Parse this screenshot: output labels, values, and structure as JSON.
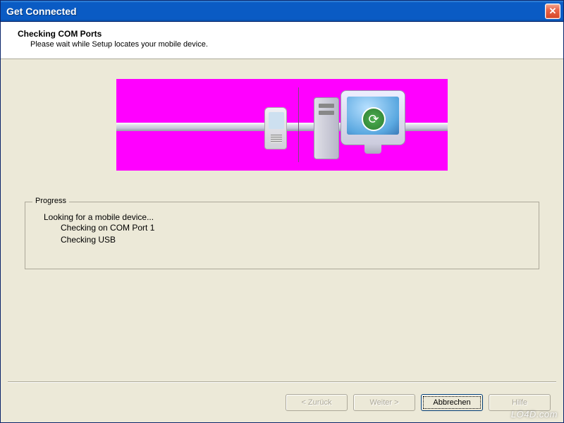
{
  "window": {
    "title": "Get Connected",
    "close_label": "✕"
  },
  "header": {
    "title": "Checking COM Ports",
    "subtitle": "Please wait while Setup locates your mobile device."
  },
  "illustration": {
    "phone_icon": "mobile-phone",
    "computer_icon": "desktop-computer",
    "sync_icon": "sync-arrows",
    "bg_color": "#ff00ff"
  },
  "progress": {
    "legend": "Progress",
    "status": "Looking for a mobile device...",
    "steps": [
      "Checking on COM Port 1",
      "Checking USB"
    ]
  },
  "buttons": {
    "back": "< Zurück",
    "next": "Weiter >",
    "cancel": "Abbrechen",
    "help": "Hilfe"
  },
  "watermark": "LO4D.com"
}
